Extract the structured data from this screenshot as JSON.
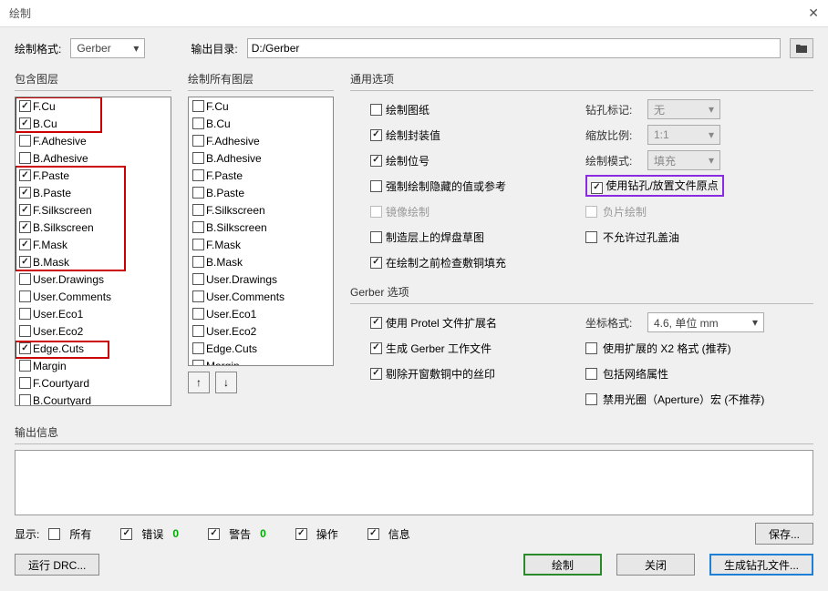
{
  "window": {
    "title": "绘制"
  },
  "top": {
    "format_label": "绘制格式:",
    "format_value": "Gerber",
    "outdir_label": "输出目录:",
    "outdir_value": "D:/Gerber"
  },
  "includeLayers": {
    "title": "包含图层",
    "items": [
      {
        "label": "F.Cu",
        "checked": true
      },
      {
        "label": "B.Cu",
        "checked": true
      },
      {
        "label": "F.Adhesive",
        "checked": false
      },
      {
        "label": "B.Adhesive",
        "checked": false
      },
      {
        "label": "F.Paste",
        "checked": true
      },
      {
        "label": "B.Paste",
        "checked": true
      },
      {
        "label": "F.Silkscreen",
        "checked": true
      },
      {
        "label": "B.Silkscreen",
        "checked": true
      },
      {
        "label": "F.Mask",
        "checked": true
      },
      {
        "label": "B.Mask",
        "checked": true
      },
      {
        "label": "User.Drawings",
        "checked": false
      },
      {
        "label": "User.Comments",
        "checked": false
      },
      {
        "label": "User.Eco1",
        "checked": false
      },
      {
        "label": "User.Eco2",
        "checked": false
      },
      {
        "label": "Edge.Cuts",
        "checked": true
      },
      {
        "label": "Margin",
        "checked": false
      },
      {
        "label": "F.Courtyard",
        "checked": false
      },
      {
        "label": "B.Courtyard",
        "checked": false
      }
    ]
  },
  "plotAllLayers": {
    "title": "绘制所有图层",
    "items": [
      {
        "label": "F.Cu",
        "checked": false
      },
      {
        "label": "B.Cu",
        "checked": false
      },
      {
        "label": "F.Adhesive",
        "checked": false
      },
      {
        "label": "B.Adhesive",
        "checked": false
      },
      {
        "label": "F.Paste",
        "checked": false
      },
      {
        "label": "B.Paste",
        "checked": false
      },
      {
        "label": "F.Silkscreen",
        "checked": false
      },
      {
        "label": "B.Silkscreen",
        "checked": false
      },
      {
        "label": "F.Mask",
        "checked": false
      },
      {
        "label": "B.Mask",
        "checked": false
      },
      {
        "label": "User.Drawings",
        "checked": false
      },
      {
        "label": "User.Comments",
        "checked": false
      },
      {
        "label": "User.Eco1",
        "checked": false
      },
      {
        "label": "User.Eco2",
        "checked": false
      },
      {
        "label": "Edge.Cuts",
        "checked": false
      },
      {
        "label": "Margin",
        "checked": false
      }
    ]
  },
  "general": {
    "title": "通用选项",
    "plot_sheet": {
      "label": "绘制图纸",
      "checked": false
    },
    "plot_fp_values": {
      "label": "绘制封装值",
      "checked": true
    },
    "plot_refs": {
      "label": "绘制位号",
      "checked": true
    },
    "force_hidden": {
      "label": "强制绘制隐藏的值或参考",
      "checked": false
    },
    "mirror": {
      "label": "镜像绘制",
      "checked": false,
      "disabled": true
    },
    "sketch_pads": {
      "label": "制造层上的焊盘草图",
      "checked": false
    },
    "check_zones": {
      "label": "在绘制之前检查敷铜填充",
      "checked": true
    },
    "drill_mark_label": "钻孔标记:",
    "drill_mark_value": "无",
    "scale_label": "缩放比例:",
    "scale_value": "1:1",
    "plot_mode_label": "绘制模式:",
    "plot_mode_value": "填充",
    "use_drill_origin": {
      "label": "使用钻孔/放置文件原点",
      "checked": true
    },
    "negative": {
      "label": "负片绘制",
      "checked": false,
      "disabled": true
    },
    "tent_vias": {
      "label": "不允许过孔盖油",
      "checked": false
    }
  },
  "gerber": {
    "title": "Gerber 选项",
    "use_protel": {
      "label": "使用 Protel 文件扩展名",
      "checked": true
    },
    "gen_job": {
      "label": "生成 Gerber 工作文件",
      "checked": true
    },
    "subtract_silk": {
      "label": "剔除开窗敷铜中的丝印",
      "checked": true
    },
    "coord_label": "坐标格式:",
    "coord_value": "4.6, 单位 mm",
    "use_x2": {
      "label": "使用扩展的 X2 格式 (推荐)",
      "checked": false
    },
    "include_net": {
      "label": "包括网络属性",
      "checked": false
    },
    "disable_aperture": {
      "label": "禁用光圈（Aperture）宏 (不推荐)",
      "checked": false
    }
  },
  "output": {
    "title": "输出信息"
  },
  "show": {
    "label": "显示:",
    "all": {
      "label": "所有",
      "checked": false
    },
    "errors": {
      "label": "错误",
      "checked": true,
      "count": "0"
    },
    "warnings": {
      "label": "警告",
      "checked": true,
      "count": "0"
    },
    "actions": {
      "label": "操作",
      "checked": true
    },
    "info": {
      "label": "信息",
      "checked": true
    },
    "save_btn": "保存..."
  },
  "actions": {
    "run_drc": "运行 DRC...",
    "plot": "绘制",
    "close": "关闭",
    "gen_drill": "生成钻孔文件..."
  }
}
